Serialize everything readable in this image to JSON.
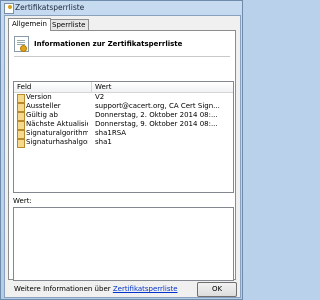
{
  "window": {
    "title": "Zertifikatsperrliste"
  },
  "tabs": [
    {
      "label": "Allgemein",
      "active": true
    },
    {
      "label": "Sperrliste",
      "active": false
    }
  ],
  "header": {
    "title": "Informationen zur Zertifikatsperrliste"
  },
  "table": {
    "columns": [
      "Feld",
      "Wert"
    ],
    "rows": [
      {
        "field": "Version",
        "value": "V2"
      },
      {
        "field": "Aussteller",
        "value": "support@cacert.org, CA Cert Sign..."
      },
      {
        "field": "Gültig ab",
        "value": "Donnerstag, 2. Oktober 2014 08:..."
      },
      {
        "field": "Nächste Aktualisier...",
        "value": "Donnerstag, 9. Oktober 2014 08:..."
      },
      {
        "field": "Signaturalgorithmus",
        "value": "sha1RSA"
      },
      {
        "field": "Signaturhashalgorit...",
        "value": "sha1"
      }
    ]
  },
  "value_panel": {
    "label": "Wert:"
  },
  "footer": {
    "more_info_prefix": "Weitere Informationen über ",
    "more_info_link": "Zertifikatsperrliste"
  },
  "buttons": {
    "ok": "OK"
  }
}
